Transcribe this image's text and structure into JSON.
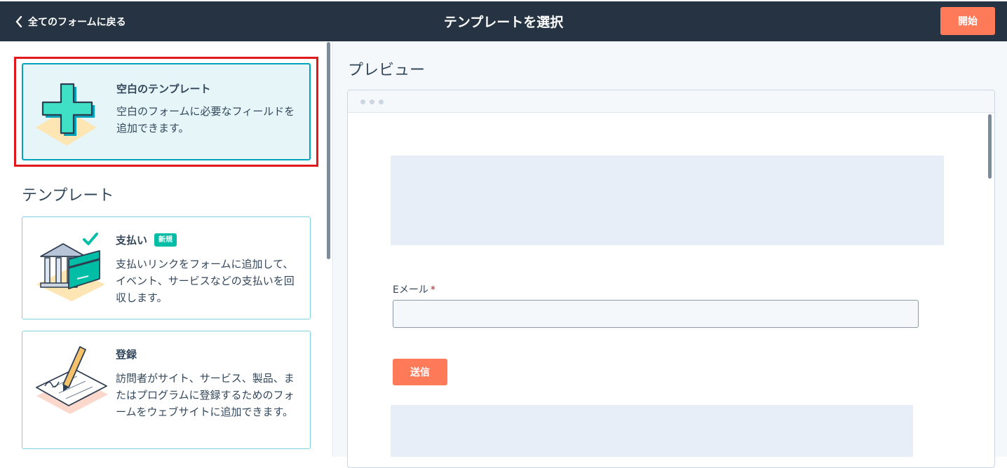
{
  "topbar": {
    "back_label": "全てのフォームに戻る",
    "title": "テンプレートを選択",
    "start_label": "開始"
  },
  "blank_template": {
    "title": "空白のテンプレート",
    "description": "空白のフォームに必要なフィールドを追加できます。"
  },
  "templates_heading": "テンプレート",
  "templates": [
    {
      "title": "支払い",
      "badge": "新規",
      "description": "支払いリンクをフォームに追加して、イベント、サービスなどの支払いを回収します。"
    },
    {
      "title": "登録",
      "description": "訪問者がサイト、サービス、製品、またはプログラムに登録するためのフォームをウェブサイトに追加できます。"
    }
  ],
  "preview": {
    "heading": "プレビュー",
    "email_label": "Eメール",
    "required_mark": "*",
    "email_value": "",
    "submit_label": "送信"
  },
  "colors": {
    "topbar_bg": "#253342",
    "accent_orange": "#ff7a59",
    "selected_border": "#00a4bd",
    "badge_green": "#00bda5",
    "highlight_red": "#e0191c"
  },
  "icons": [
    "chevron-left-icon",
    "plus-icon",
    "bank-card-icon",
    "checkmark-icon",
    "pen-paper-icon"
  ]
}
